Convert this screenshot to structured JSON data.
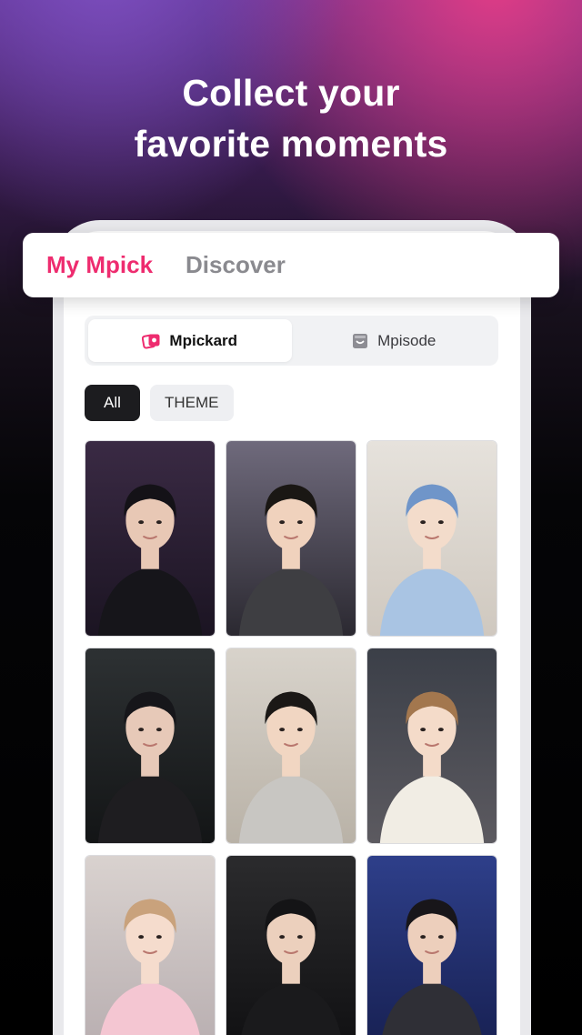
{
  "headline": {
    "line1": "Collect your",
    "line2": "favorite moments"
  },
  "main_tabs": [
    {
      "label": "My Mpick",
      "active": true
    },
    {
      "label": "Discover",
      "active": false
    }
  ],
  "segment": [
    {
      "label": "Mpickard",
      "icon": "mpickard-card-icon",
      "active": true
    },
    {
      "label": "Mpisode",
      "icon": "mpisode-album-icon",
      "active": false
    }
  ],
  "filters": [
    {
      "label": "All",
      "active": true
    },
    {
      "label": "THEME",
      "active": false
    }
  ],
  "colors": {
    "accent": "#ee2c6f",
    "dark_chip": "#1c1c1f"
  },
  "cards": [
    {
      "name": "photo-card-street-style",
      "bg": [
        "#3a2a44",
        "#1b1422"
      ],
      "hair": "#141217",
      "outfit": "#16151a",
      "skin": "#e8c8b5"
    },
    {
      "name": "photo-card-studio-selfie",
      "bg": [
        "#6f6a7c",
        "#2b2931"
      ],
      "hair": "#1a1714",
      "outfit": "#3e3e42",
      "skin": "#f0d2bd"
    },
    {
      "name": "photo-card-blue-hair",
      "bg": [
        "#e6e2dc",
        "#cfc8bf"
      ],
      "hair": "#6f95c9",
      "outfit": "#a9c4e3",
      "skin": "#f3dccb"
    },
    {
      "name": "photo-card-backstage",
      "bg": [
        "#2d3133",
        "#131516"
      ],
      "hair": "#16161a",
      "outfit": "#1e1d20",
      "skin": "#e7c9b8"
    },
    {
      "name": "photo-card-living-room",
      "bg": [
        "#d8d3cb",
        "#b9b2a7"
      ],
      "hair": "#1b1816",
      "outfit": "#c8c6c2",
      "skin": "#f1d6c2"
    },
    {
      "name": "photo-card-peace-sign",
      "bg": [
        "#3b3f48",
        "#5c5a60"
      ],
      "hair": "#a3774e",
      "outfit": "#f1ede4",
      "skin": "#f4dbc9"
    },
    {
      "name": "photo-card-pink-outfit",
      "bg": [
        "#d9d2cf",
        "#b8aeb0"
      ],
      "hair": "#c9a27c",
      "outfit": "#f4c6d2",
      "skin": "#f5dccd"
    },
    {
      "name": "photo-card-car-selfie",
      "bg": [
        "#2b2b2d",
        "#101012"
      ],
      "hair": "#141416",
      "outfit": "#1a1a1c",
      "skin": "#ecd0bd"
    },
    {
      "name": "photo-card-stage-concert",
      "bg": [
        "#2e3f8a",
        "#172052"
      ],
      "hair": "#18161a",
      "outfit": "#2f2f36",
      "skin": "#edcfbc"
    }
  ]
}
